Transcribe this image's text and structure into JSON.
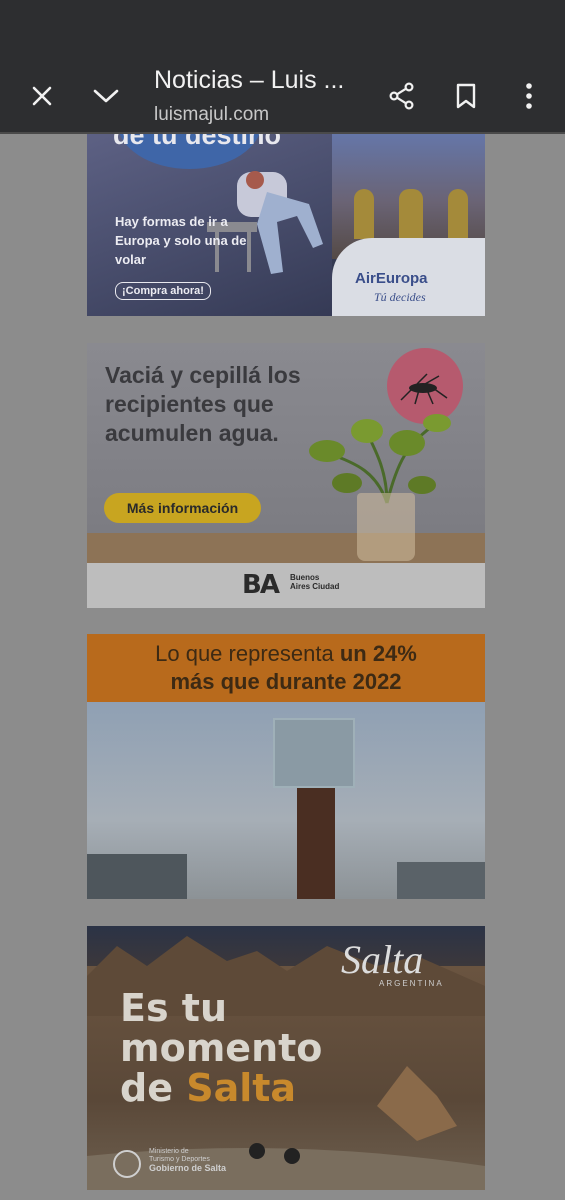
{
  "topbar": {
    "title": "Noticias – Luis ...",
    "url": "luismajul.com",
    "icons": [
      "close-icon",
      "chevron-down-icon",
      "share-icon",
      "bookmark-icon",
      "more-vert-icon"
    ]
  },
  "ads": {
    "air_europa": {
      "headline_partial": "de tu destino",
      "copy": "Hay formas de ir a Europa y solo una de volar",
      "cta": "¡Compra ahora!",
      "logo": "AirEuropa",
      "tagline": "Tú decides"
    },
    "ba_ciudad": {
      "copy": "Vaciá y cepillá los recipientes que acumulen agua.",
      "button": "Más información",
      "logo": "BA",
      "logo_sub": "Buenos Aires Ciudad"
    },
    "tourism_stats": {
      "line1_normal": "Lo que representa ",
      "line1_bold": "un 24%",
      "line2_bold": "más que durante 2022"
    },
    "salta": {
      "brand": "Salta",
      "brand_sub": "ARGENTINA",
      "line1": "Es tu",
      "line2": "momento",
      "line3_a": "de ",
      "line3_b": "Salta",
      "ministry_line1": "Ministerio de",
      "ministry_line2": "Turismo y Deportes",
      "ministry_line3": "Gobierno de Salta"
    }
  },
  "colors": {
    "topbar": "#2d2e30",
    "overlay": "#8c8c8c",
    "accent_orange": "#b86a1c",
    "ba_yellow": "#c8a520"
  }
}
